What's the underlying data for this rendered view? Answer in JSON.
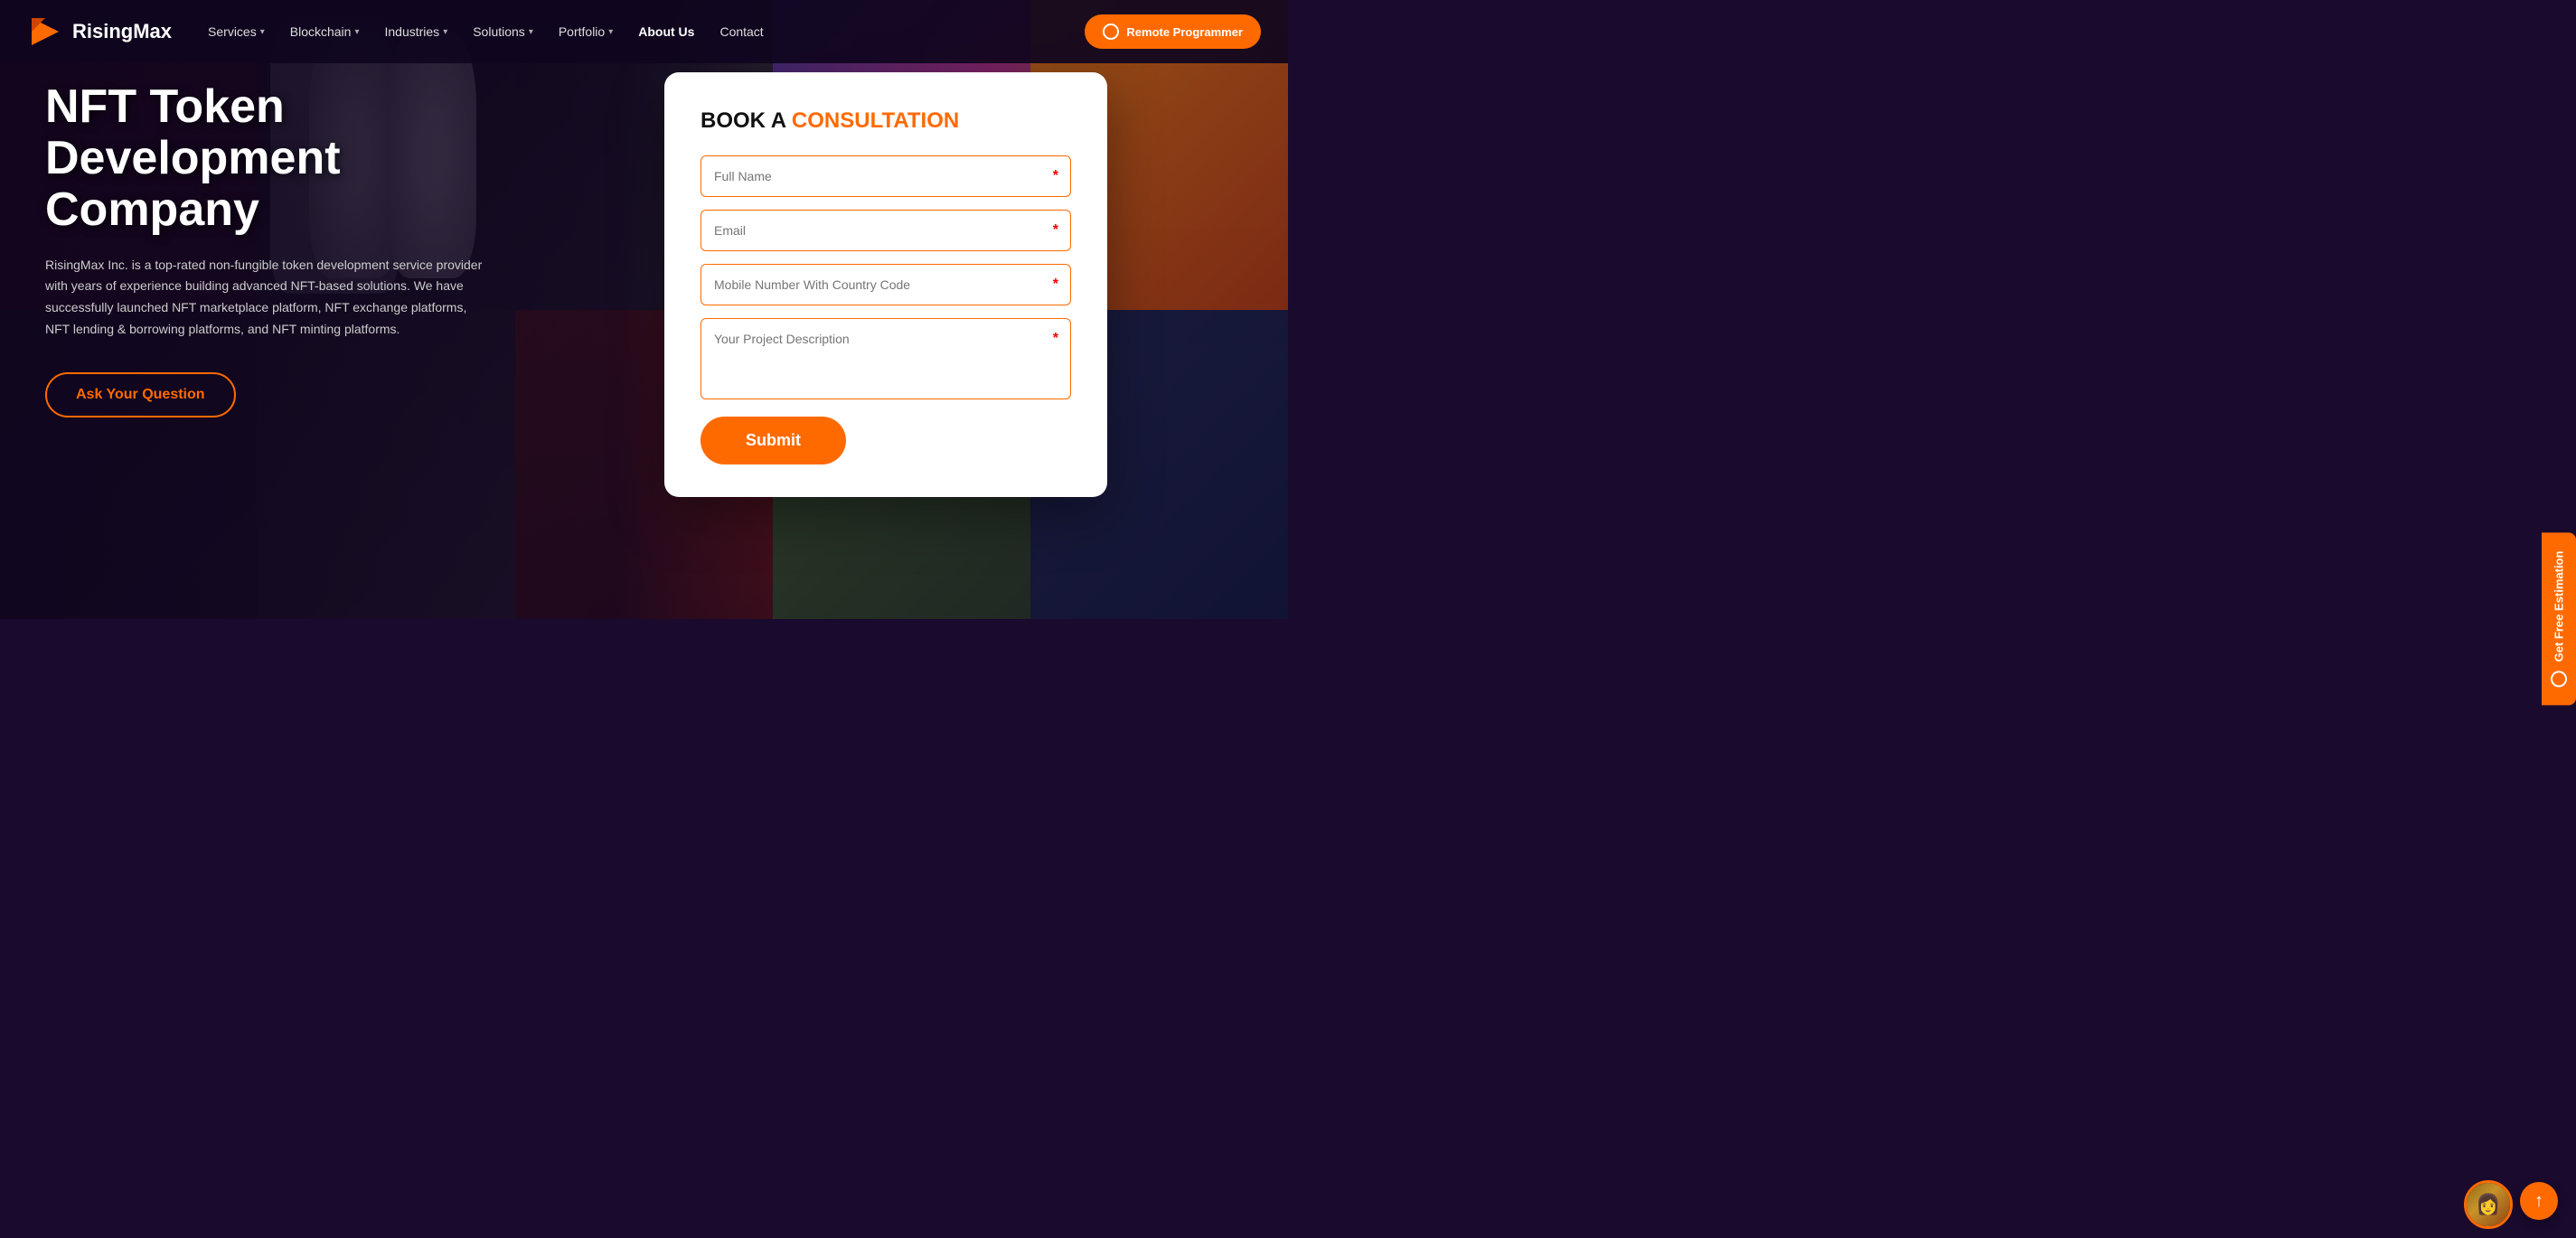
{
  "nav": {
    "logo_text": "RisingMax",
    "items": [
      {
        "label": "Services",
        "has_dropdown": true
      },
      {
        "label": "Blockchain",
        "has_dropdown": true
      },
      {
        "label": "Industries",
        "has_dropdown": true
      },
      {
        "label": "Solutions",
        "has_dropdown": true
      },
      {
        "label": "Portfolio",
        "has_dropdown": true
      },
      {
        "label": "About Us",
        "has_dropdown": false
      },
      {
        "label": "Contact",
        "has_dropdown": false
      }
    ],
    "cta_button": "Remote Programmer"
  },
  "hero": {
    "title": "NFT Token Development Company",
    "description": "RisingMax Inc. is a top-rated non-fungible token development service provider with years of experience building advanced NFT-based solutions. We have successfully launched NFT marketplace platform, NFT exchange platforms, NFT lending & borrowing platforms, and NFT minting platforms.",
    "cta_button": "Ask Your Question"
  },
  "form": {
    "title_prefix": "BOOK A ",
    "title_highlight": "CONSULTATION",
    "fields": {
      "full_name_placeholder": "Full Name",
      "email_placeholder": "Email",
      "mobile_placeholder": "Mobile Number With Country Code",
      "description_placeholder": "Your Project Description"
    },
    "submit_label": "Submit"
  },
  "side_badge": {
    "label": "Get Free Estimation"
  },
  "scroll_top_icon": "↑"
}
